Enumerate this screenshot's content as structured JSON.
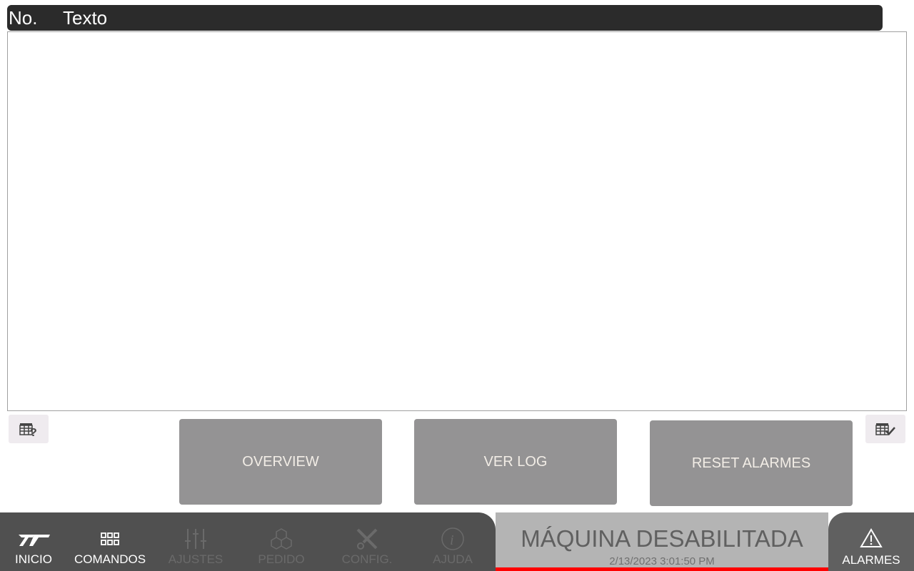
{
  "table": {
    "columns": [
      "No.",
      "Texto"
    ],
    "rows": []
  },
  "buttons": {
    "overview": "OVERVIEW",
    "ver_log": "VER LOG",
    "reset": "RESET ALARMES"
  },
  "nav": [
    {
      "label": "INICIO",
      "icon": "logo-icon",
      "enabled": true
    },
    {
      "label": "COMANDOS",
      "icon": "grid-icon",
      "enabled": true
    },
    {
      "label": "AJUSTES",
      "icon": "sliders-icon",
      "enabled": false
    },
    {
      "label": "PEDIDO",
      "icon": "cubes-icon",
      "enabled": false
    },
    {
      "label": "CONFIG.",
      "icon": "tools-icon",
      "enabled": false
    },
    {
      "label": "AJUDA",
      "icon": "info-icon",
      "enabled": false
    }
  ],
  "status": {
    "title": "MÁQUINA DESABILITADA",
    "datetime": "2/13/2023 3:01:50 PM",
    "indicator_color": "#ff0000"
  },
  "alarms": {
    "label": "ALARMES"
  }
}
